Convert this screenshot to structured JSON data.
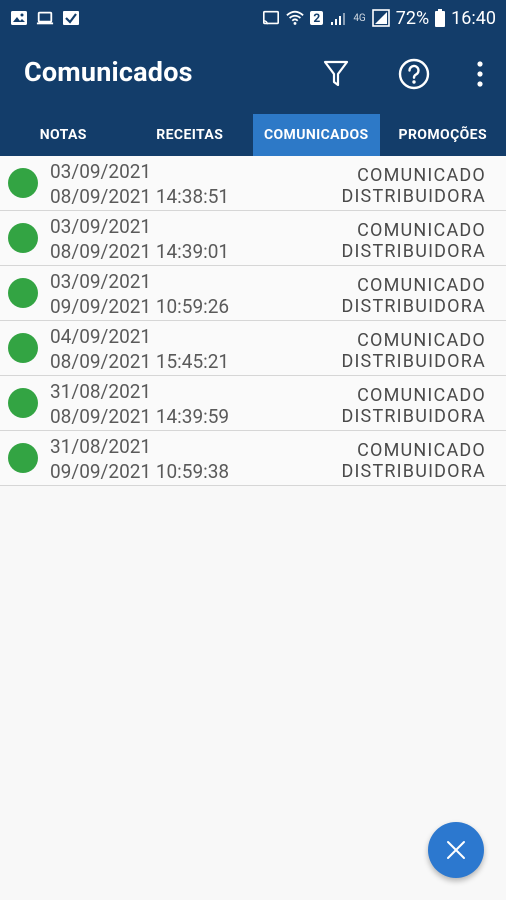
{
  "status_bar": {
    "battery": "72%",
    "time": "16:40",
    "network_badge": "2",
    "network_type": "4G",
    "left_icons": [
      "image-icon",
      "laptop-icon",
      "check-icon"
    ]
  },
  "app_bar": {
    "title": "Comunicados",
    "actions": [
      "filter-icon",
      "help-icon",
      "more-vert-icon"
    ]
  },
  "tabs": [
    {
      "label": "NOTAS",
      "active": false
    },
    {
      "label": "RECEITAS",
      "active": false
    },
    {
      "label": "COMUNICADOS",
      "active": true
    },
    {
      "label": "PROMOÇÕES",
      "active": false
    }
  ],
  "items": [
    {
      "date": "03/09/2021",
      "datetime": "08/09/2021 14:38:51",
      "type": "COMUNICADO",
      "source": "DISTRIBUIDORA",
      "status_color": "#33a443"
    },
    {
      "date": "03/09/2021",
      "datetime": "08/09/2021 14:39:01",
      "type": "COMUNICADO",
      "source": "DISTRIBUIDORA",
      "status_color": "#33a443"
    },
    {
      "date": "03/09/2021",
      "datetime": "09/09/2021 10:59:26",
      "type": "COMUNICADO",
      "source": "DISTRIBUIDORA",
      "status_color": "#33a443"
    },
    {
      "date": "04/09/2021",
      "datetime": "08/09/2021 15:45:21",
      "type": "COMUNICADO",
      "source": "DISTRIBUIDORA",
      "status_color": "#33a443"
    },
    {
      "date": "31/08/2021",
      "datetime": "08/09/2021 14:39:59",
      "type": "COMUNICADO",
      "source": "DISTRIBUIDORA",
      "status_color": "#33a443"
    },
    {
      "date": "31/08/2021",
      "datetime": "09/09/2021 10:59:38",
      "type": "COMUNICADO",
      "source": "DISTRIBUIDORA",
      "status_color": "#33a443"
    }
  ],
  "fab": {
    "icon": "close-icon"
  },
  "colors": {
    "primary": "#133d6a",
    "tab_active": "#2d79c7",
    "accent": "#2c78cf",
    "status_green": "#33a443"
  }
}
